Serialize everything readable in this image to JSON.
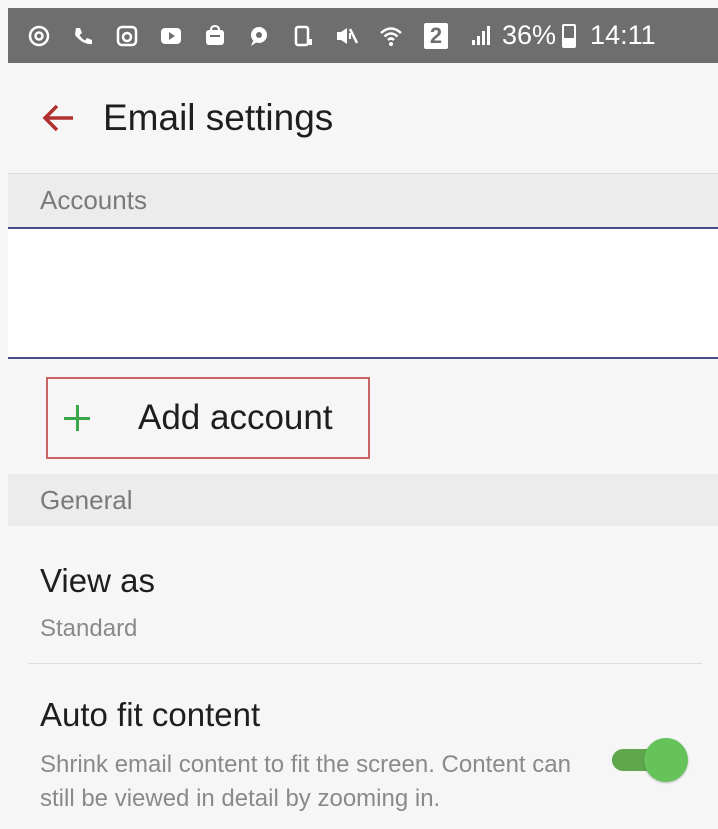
{
  "status_bar": {
    "icons": [
      "at-icon",
      "phone-icon",
      "instagram-icon",
      "youtube-icon",
      "bag-icon",
      "chat-icon",
      "screen-icon",
      "mute-icon",
      "wifi-icon",
      "sim-icon",
      "signal-icon"
    ],
    "sim_number": "2",
    "battery_percent": "36%",
    "battery_level": 0.36,
    "time": "14:11"
  },
  "app_bar": {
    "title": "Email settings",
    "back_icon": "arrow-left-icon"
  },
  "sections": {
    "accounts": "Accounts",
    "general": "General"
  },
  "add_account": {
    "label": "Add account",
    "icon": "plus-icon"
  },
  "settings": {
    "view_as": {
      "title": "View as",
      "value": "Standard"
    },
    "auto_fit": {
      "title": "Auto fit content",
      "description": "Shrink email content to fit the screen. Content can still be viewed in detail by zooming in.",
      "enabled": true
    }
  },
  "colors": {
    "accent_back": "#b03030",
    "plus": "#3aa84a",
    "toggle_on": "#66c35a",
    "highlight_border": "#c86464"
  }
}
